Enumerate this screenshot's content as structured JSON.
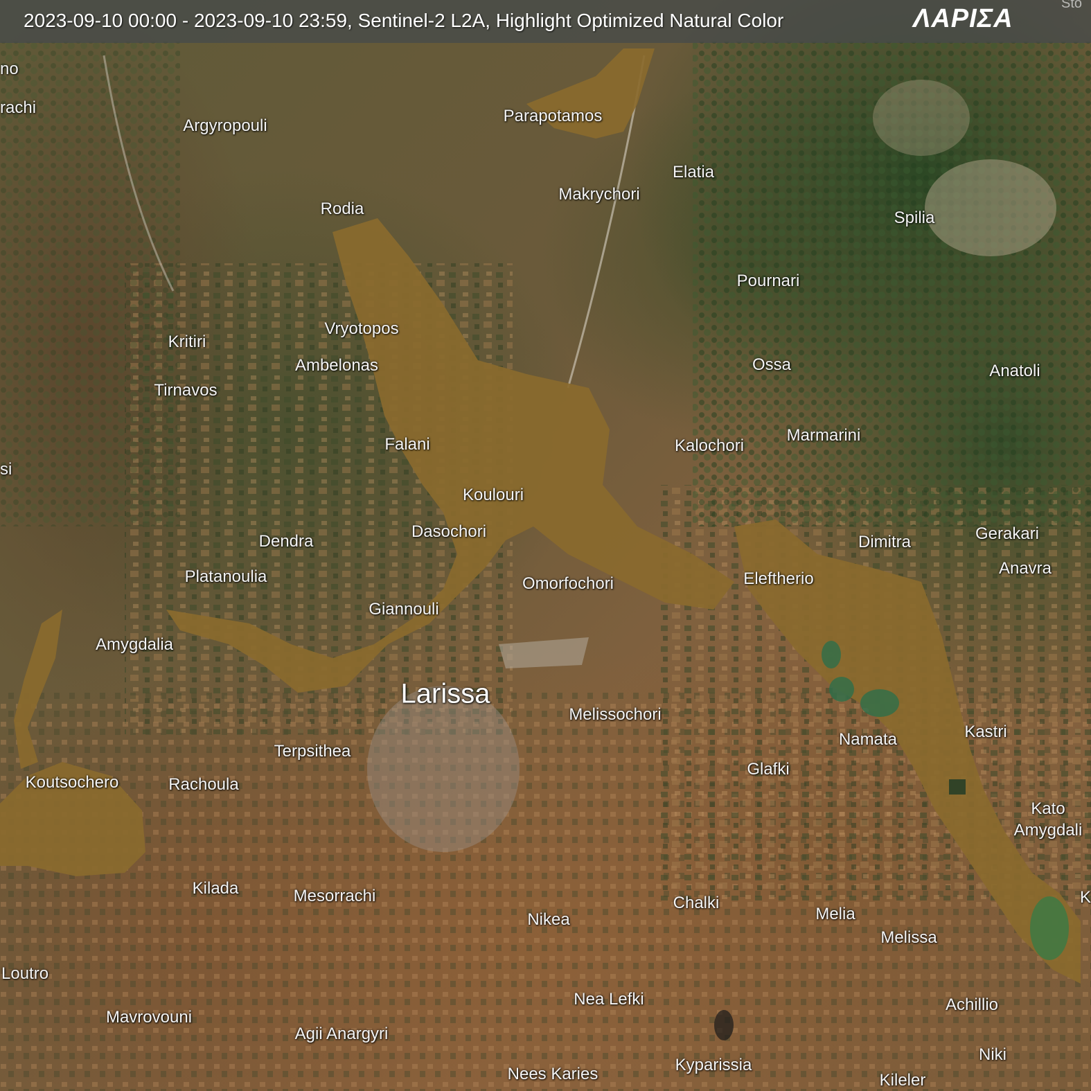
{
  "header": {
    "caption": "2023-09-10 00:00 - 2023-09-10 23:59, Sentinel-2 L2A, Highlight Optimized Natural Color",
    "region_title": "ΛΑΡΙΣΑ",
    "corner_text": "Sto"
  },
  "colors": {
    "flood_water": "#8a6a2e",
    "forest": "#2f4a28",
    "farmland": "#7a5a38",
    "header_bar": "#464a4a"
  },
  "map": {
    "major_city": "Larissa",
    "places": [
      {
        "id": "no",
        "name": "no"
      },
      {
        "id": "rachi",
        "name": "rachi"
      },
      {
        "id": "argyropouli",
        "name": "Argyropouli"
      },
      {
        "id": "parapotamos",
        "name": "Parapotamos"
      },
      {
        "id": "elatia",
        "name": "Elatia"
      },
      {
        "id": "makrychori",
        "name": "Makrychori"
      },
      {
        "id": "rodia",
        "name": "Rodia"
      },
      {
        "id": "spilia",
        "name": "Spilia"
      },
      {
        "id": "pournari",
        "name": "Pournari"
      },
      {
        "id": "vryotopos",
        "name": "Vryotopos"
      },
      {
        "id": "kritiri",
        "name": "Kritiri"
      },
      {
        "id": "ambelonas",
        "name": "Ambelonas"
      },
      {
        "id": "ossa",
        "name": "Ossa"
      },
      {
        "id": "anatoli",
        "name": "Anatoli"
      },
      {
        "id": "tirnavos",
        "name": "Tirnavos"
      },
      {
        "id": "falani",
        "name": "Falani"
      },
      {
        "id": "kalochori",
        "name": "Kalochori"
      },
      {
        "id": "marmarini",
        "name": "Marmarini"
      },
      {
        "id": "si",
        "name": "si"
      },
      {
        "id": "koulouri",
        "name": "Koulouri"
      },
      {
        "id": "dasochori",
        "name": "Dasochori"
      },
      {
        "id": "dendra",
        "name": "Dendra"
      },
      {
        "id": "dimitra",
        "name": "Dimitra"
      },
      {
        "id": "gerakari",
        "name": "Gerakari"
      },
      {
        "id": "anavra",
        "name": "Anavra"
      },
      {
        "id": "platanoulia",
        "name": "Platanoulia"
      },
      {
        "id": "omorfochori",
        "name": "Omorfochori"
      },
      {
        "id": "eleftherio",
        "name": "Eleftherio"
      },
      {
        "id": "giannouli",
        "name": "Giannouli"
      },
      {
        "id": "amygdalia",
        "name": "Amygdalia"
      },
      {
        "id": "melissochori",
        "name": "Melissochori"
      },
      {
        "id": "namata",
        "name": "Namata"
      },
      {
        "id": "kastri",
        "name": "Kastri"
      },
      {
        "id": "terpsithea",
        "name": "Terpsithea"
      },
      {
        "id": "glafki",
        "name": "Glafki"
      },
      {
        "id": "koutsochero",
        "name": "Koutsochero"
      },
      {
        "id": "rachoula",
        "name": "Rachoula"
      },
      {
        "id": "kato-amygdali-1",
        "name": "Kato"
      },
      {
        "id": "kato-amygdali-2",
        "name": "Amygdali"
      },
      {
        "id": "kilada",
        "name": "Kilada"
      },
      {
        "id": "mesorrachi",
        "name": "Mesorrachi"
      },
      {
        "id": "chalki",
        "name": "Chalki"
      },
      {
        "id": "melia",
        "name": "Melia"
      },
      {
        "id": "nikea",
        "name": "Nikea"
      },
      {
        "id": "melissa",
        "name": "Melissa"
      },
      {
        "id": "loutro",
        "name": "Loutro"
      },
      {
        "id": "nea-lefki",
        "name": "Nea Lefki"
      },
      {
        "id": "achillio",
        "name": "Achillio"
      },
      {
        "id": "mavrovouni",
        "name": "Mavrovouni"
      },
      {
        "id": "agii-anargyri",
        "name": "Agii Anargyri"
      },
      {
        "id": "niki",
        "name": "Niki"
      },
      {
        "id": "nees-karies",
        "name": "Nees Karies"
      },
      {
        "id": "kyparissia",
        "name": "Kyparissia"
      },
      {
        "id": "kileler",
        "name": "Kileler"
      },
      {
        "id": "edge-k1",
        "name": "K"
      },
      {
        "id": "edge-k2",
        "name": "K"
      }
    ]
  }
}
